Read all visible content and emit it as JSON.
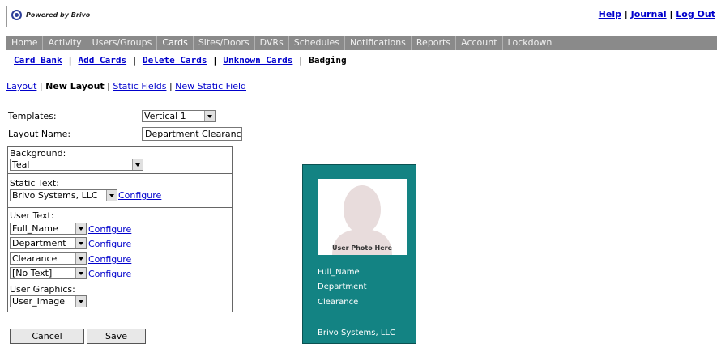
{
  "header": {
    "brand": "Powered by Brivo",
    "links": [
      "Help",
      "Journal",
      "Log Out"
    ]
  },
  "nav": {
    "tabs": [
      "Home",
      "Activity",
      "Users/Groups",
      "Cards",
      "Sites/Doors",
      "DVRs",
      "Schedules",
      "Notifications",
      "Reports",
      "Account",
      "Lockdown"
    ],
    "active": "Cards"
  },
  "subnav": {
    "links": [
      "Card Bank",
      "Add Cards",
      "Delete Cards",
      "Unknown Cards"
    ],
    "current": "Badging"
  },
  "layout_links": {
    "layout": "Layout",
    "current": "New Layout",
    "static_fields": "Static Fields",
    "new_static_field": "New Static Field"
  },
  "form": {
    "templates_label": "Templates:",
    "templates_value": "Vertical 1",
    "layout_name_label": "Layout Name:",
    "layout_name_value": "Department Clearanc",
    "background_label": "Background:",
    "background_value": "Teal",
    "static_text_label": "Static Text:",
    "static_text_value": "Brivo Systems, LLC",
    "configure": "Configure",
    "user_text_label": "User Text:",
    "user_text_values": [
      "Full_Name",
      "Department",
      "Clearance",
      "[No Text]"
    ],
    "user_graphics_label": "User Graphics:",
    "user_graphics_value": "User_Image",
    "cancel": "Cancel",
    "save": "Save"
  },
  "badge": {
    "background_color": "#138383",
    "photo_label": "User Photo Here",
    "lines": [
      "Full_Name",
      "Department",
      "Clearance"
    ],
    "footer": "Brivo Systems, LLC"
  }
}
